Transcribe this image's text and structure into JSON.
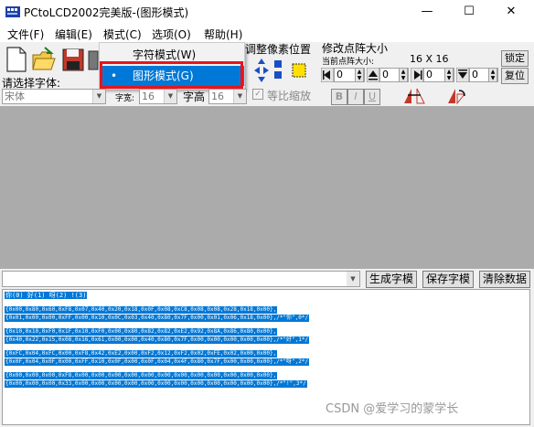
{
  "window": {
    "title": "PCtoLCD2002完美版-(图形模式)",
    "minimize": "—",
    "maximize": "☐",
    "close": "✕"
  },
  "menu": [
    "文件(F)",
    "编辑(E)",
    "模式(C)",
    "选项(O)",
    "帮助(H)"
  ],
  "dropdown": {
    "items": [
      {
        "label": "字符模式(W)",
        "selected": false
      },
      {
        "label": "图形模式(G)",
        "selected": true
      }
    ],
    "bullet": "•",
    "highlight_color": "#e8141c"
  },
  "toolbar": {
    "adjust_pixel_label": "调整像素位置",
    "resize_label": "修改点阵大小",
    "current_size_label": "当前点阵大小:",
    "current_size_value": "16 X 16",
    "lock_button": "锁定",
    "restore_button": "复位",
    "spin_values": [
      "0",
      "0",
      "0",
      "0"
    ]
  },
  "font_row": {
    "label": "请选择字体:",
    "font_value": "宋体",
    "width_label": "字宽:",
    "width_value": "16",
    "height_label": "字高",
    "height_value": "16",
    "proportional_label": "等比缩放",
    "bold": "B",
    "italic": "I",
    "underline": "U"
  },
  "actions": {
    "input_value": "",
    "generate": "生成字模",
    "save": "保存字模",
    "clear": "清除数据"
  },
  "output_lines": [
    "你(0) 好(1) 呀(2) !(3)",
    "{0x00,0x80,0x60,0xF8,0x07,0x40,0x20,0x18,0x0F,0x08,0xC8,0x08,0x08,0x28,0x18,0x00},",
    "{0x01,0x00,0x00,0xFF,0x00,0x10,0x0C,0x03,0x40,0x80,0x7F,0x00,0x01,0x06,0x18,0x00},/*\"你\",0*/",
    "{0x10,0x10,0xF0,0x1F,0x10,0xF0,0x00,0x80,0x82,0x82,0xE2,0x92,0x8A,0x86,0x80,0x00},",
    "{0x40,0x22,0x15,0x08,0x16,0x61,0x00,0x00,0x40,0x80,0x7F,0x00,0x00,0x00,0x00,0x00},/*\"好\",1*/",
    "{0xFC,0x04,0xFC,0x00,0xF8,0x42,0xE2,0x00,0xF2,0x12,0xF2,0x02,0xFE,0x02,0x00,0x00},",
    "{0x0F,0x04,0x0F,0x00,0xFF,0x10,0x0F,0x00,0x0F,0x04,0x4F,0x80,0x7F,0x00,0x00,0x00},/*\"呀\",2*/",
    "{0x00,0x00,0x00,0xF8,0x00,0x00,0x00,0x00,0x00,0x00,0x00,0x00,0x00,0x00,0x00,0x00},",
    "{0x00,0x00,0x00,0x33,0x00,0x00,0x00,0x00,0x00,0x00,0x00,0x00,0x00,0x00,0x00,0x00},/*\"!\",3*/"
  ],
  "watermark": "CSDN @爱学习的蒙学长",
  "colors": {
    "selection": "#0078d7",
    "canvas": "#ababab",
    "panel": "#f0f0f0"
  }
}
